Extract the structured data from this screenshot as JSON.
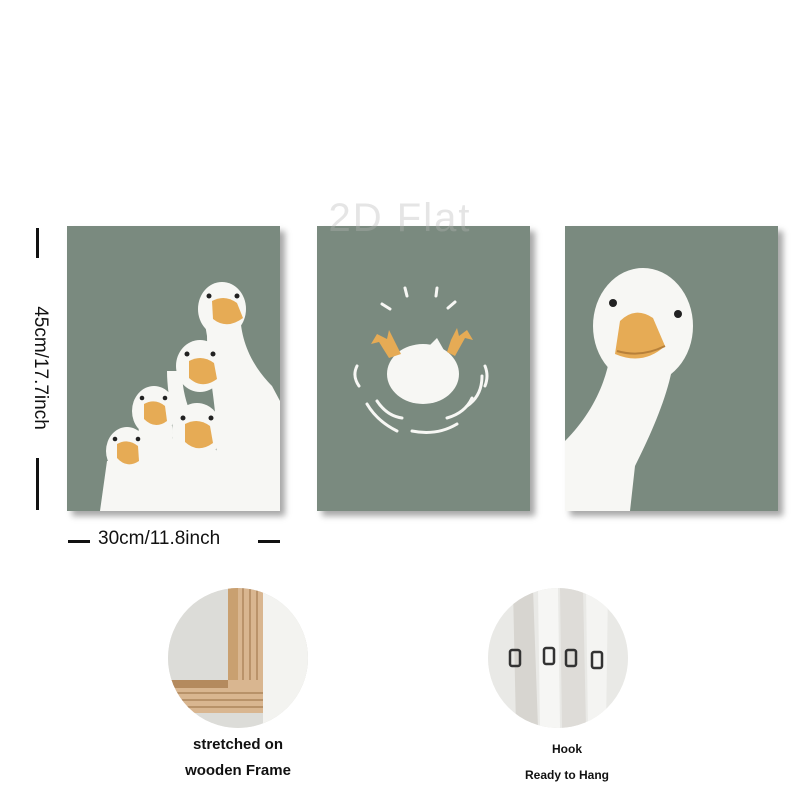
{
  "watermark": "2D Flat",
  "panels": [
    {
      "name": "geese-group-panel",
      "color": "#7a8a7f"
    },
    {
      "name": "splash-goose-panel",
      "color": "#7a8a7f"
    },
    {
      "name": "curious-goose-panel",
      "color": "#7a8a7f"
    }
  ],
  "dimensions": {
    "height_label": "45cm/17.7inch",
    "width_label": "30cm/11.8inch"
  },
  "features": [
    {
      "caption_line1": "stretched on",
      "caption_line2": "wooden Frame",
      "icon": "wooden-frame-image"
    },
    {
      "caption_line1": "Hook",
      "caption_line2": "Ready to Hang",
      "icon": "hook-image"
    }
  ],
  "colors": {
    "canvas_bg": "#7a8a7f",
    "goose_white": "#f7f7f4",
    "beak": "#e6ab55",
    "text": "#111111"
  }
}
